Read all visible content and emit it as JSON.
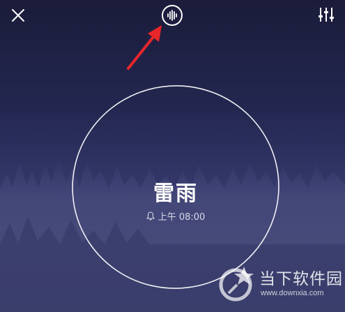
{
  "header": {
    "close_icon": "close-icon",
    "sound_icon": "sound-wave-icon",
    "settings_icon": "equalizer-settings-icon"
  },
  "annotation": {
    "arrow_color": "#e8262a"
  },
  "scene": {
    "title": "雷雨",
    "alarm_icon": "bell-icon",
    "alarm_time": "上午 08:00"
  },
  "watermark": {
    "name": "当下软件园",
    "url": "www.downxia.com"
  },
  "colors": {
    "background_top": "#1b1c3a",
    "background_bottom": "#3e426f",
    "ring": "#ffffff"
  }
}
